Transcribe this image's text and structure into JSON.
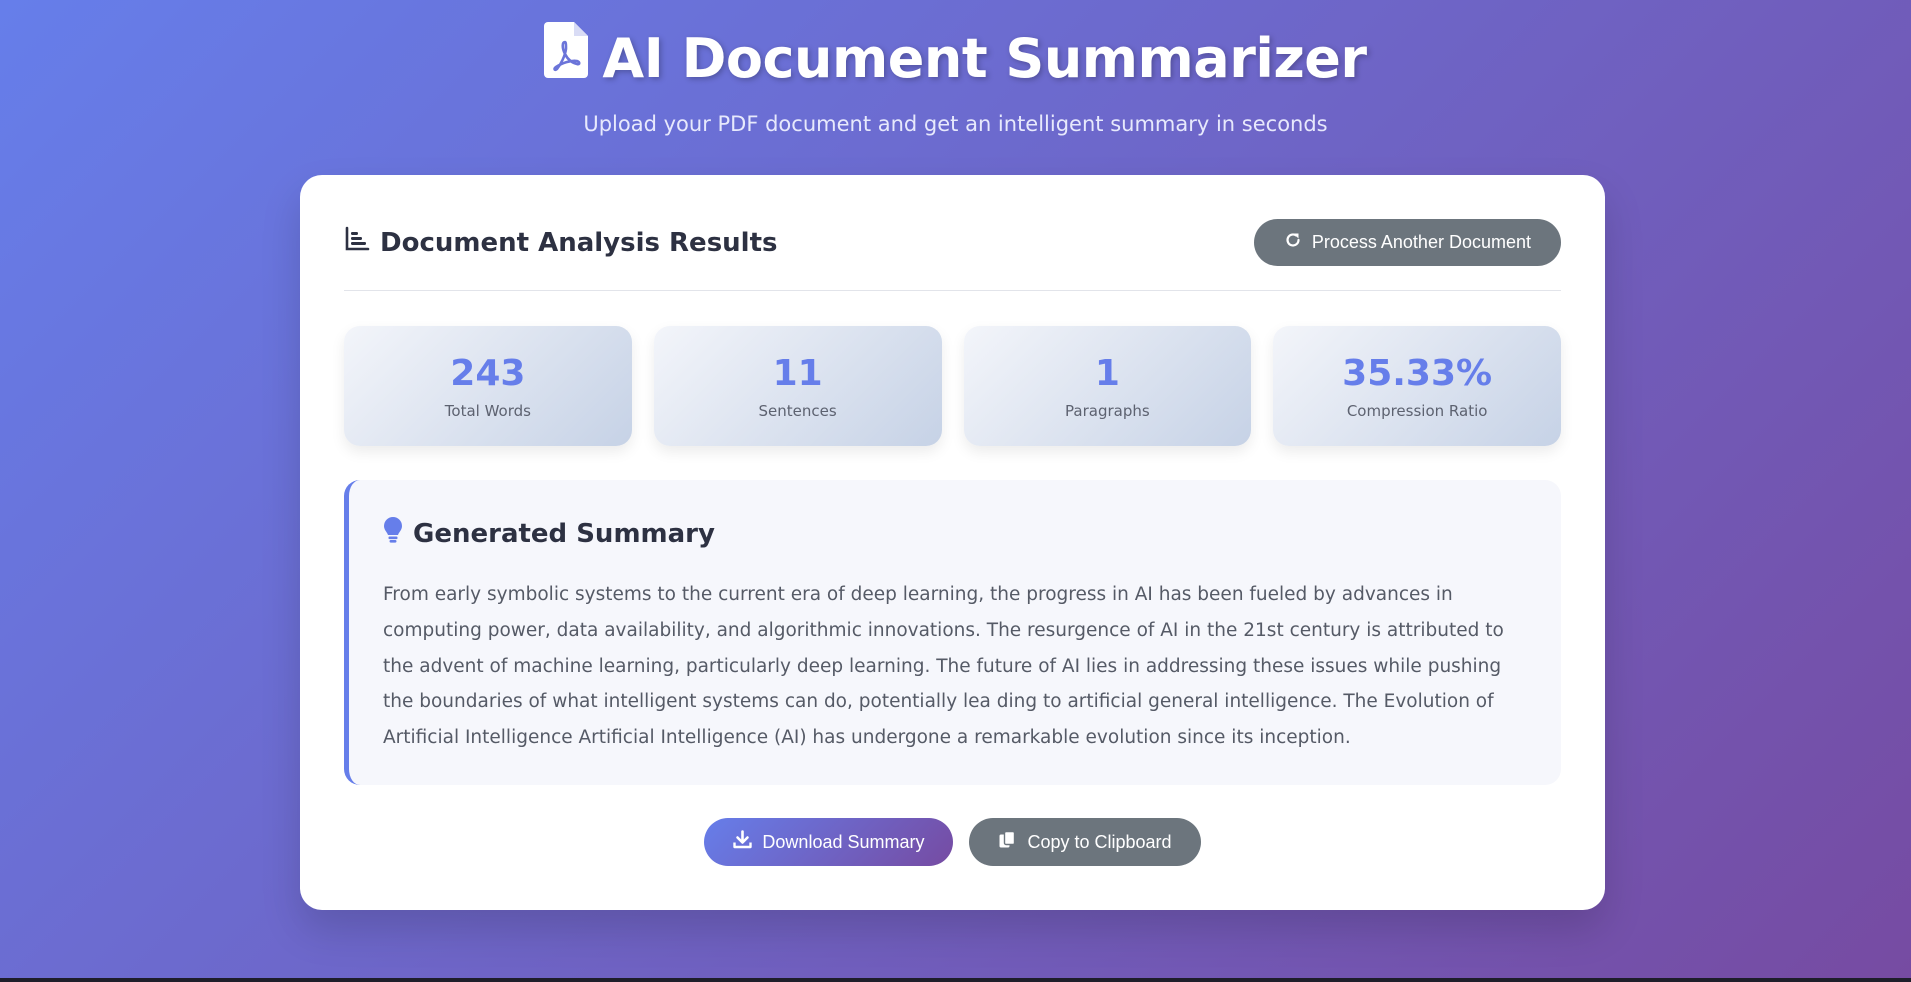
{
  "header": {
    "title": "AI Document Summarizer",
    "subtitle": "Upload your PDF document and get an intelligent summary in seconds",
    "icon": "file-pdf-icon"
  },
  "results": {
    "title": "Document Analysis Results",
    "title_icon": "chart-bar-icon",
    "process_another_label": "Process Another Document",
    "process_icon": "redo-icon"
  },
  "stats": [
    {
      "value": "243",
      "label": "Total Words"
    },
    {
      "value": "11",
      "label": "Sentences"
    },
    {
      "value": "1",
      "label": "Paragraphs"
    },
    {
      "value": "35.33%",
      "label": "Compression Ratio"
    }
  ],
  "summary": {
    "heading": "Generated Summary",
    "icon": "lightbulb-icon",
    "text": "From early symbolic systems to the current era of deep learning, the progress in AI has been fueled by advances in computing power, data availability, and algorithmic innovations. The resurgence of AI in the 21st century is attributed to the advent of machine learning, particularly deep learning. The future of AI lies in addressing these issues while pushing the boundaries of what intelligent systems can do, potentially lea ding to artificial general intelligence. The Evolution of Artificial Intelligence Artificial Intelligence (AI) has undergone a remarkable evolution since its inception."
  },
  "actions": {
    "download_label": "Download Summary",
    "download_icon": "download-icon",
    "copy_label": "Copy to Clipboard",
    "copy_icon": "copy-icon"
  },
  "colors": {
    "accent": "#667eea",
    "accent_end": "#764ba2",
    "secondary_button": "#6c757d"
  }
}
